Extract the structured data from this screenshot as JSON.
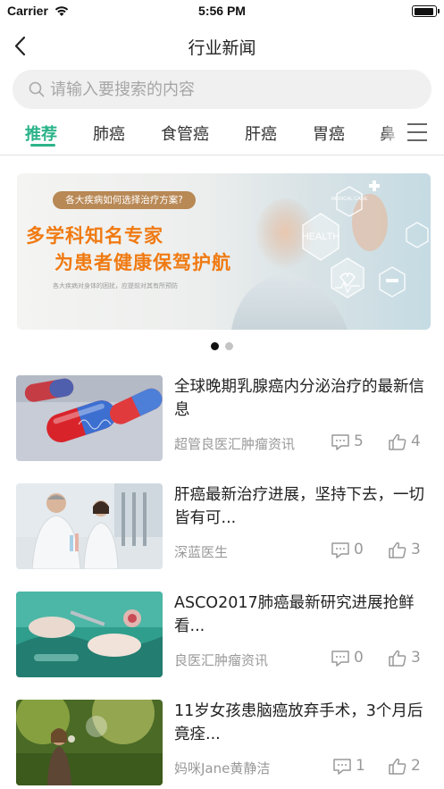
{
  "status_bar": {
    "carrier": "Carrier",
    "time": "5:56 PM"
  },
  "nav": {
    "title": "行业新闻"
  },
  "search": {
    "placeholder": "请输入要搜索的内容"
  },
  "tabs": [
    "推荐",
    "肺癌",
    "食管癌",
    "肝癌",
    "胃癌",
    "鼻"
  ],
  "banner": {
    "pill": "各大疾病如何选择治疗方案?",
    "line1": "多学科知名专家",
    "line2": "为患者健康保驾护航",
    "small": "各大疾病对身体的困扰，应提前对其有所预防",
    "art_labels": {
      "health": "HEALTH",
      "medical_care": "MEDICAL CARE"
    }
  },
  "accent_color": "#2bb38a",
  "news": [
    {
      "title": "全球晚期乳腺癌内分泌治疗的最新信息",
      "source": "超管良医汇肿瘤资讯",
      "comments": "5",
      "likes": "4",
      "thumb": "pills"
    },
    {
      "title": "肝癌最新治疗进展，坚持下去，一切皆有可...",
      "source": "深蓝医生",
      "comments": "0",
      "likes": "3",
      "thumb": "lab"
    },
    {
      "title": "ASCO2017肺癌最新研究进展抢鲜看...",
      "source": "良医汇肿瘤资讯",
      "comments": "0",
      "likes": "3",
      "thumb": "surgery"
    },
    {
      "title": "11岁女孩患脑癌放弃手术，3个月后竟痊...",
      "source": "妈咪Jane黄静洁",
      "comments": "1",
      "likes": "2",
      "thumb": "girl-field"
    }
  ]
}
